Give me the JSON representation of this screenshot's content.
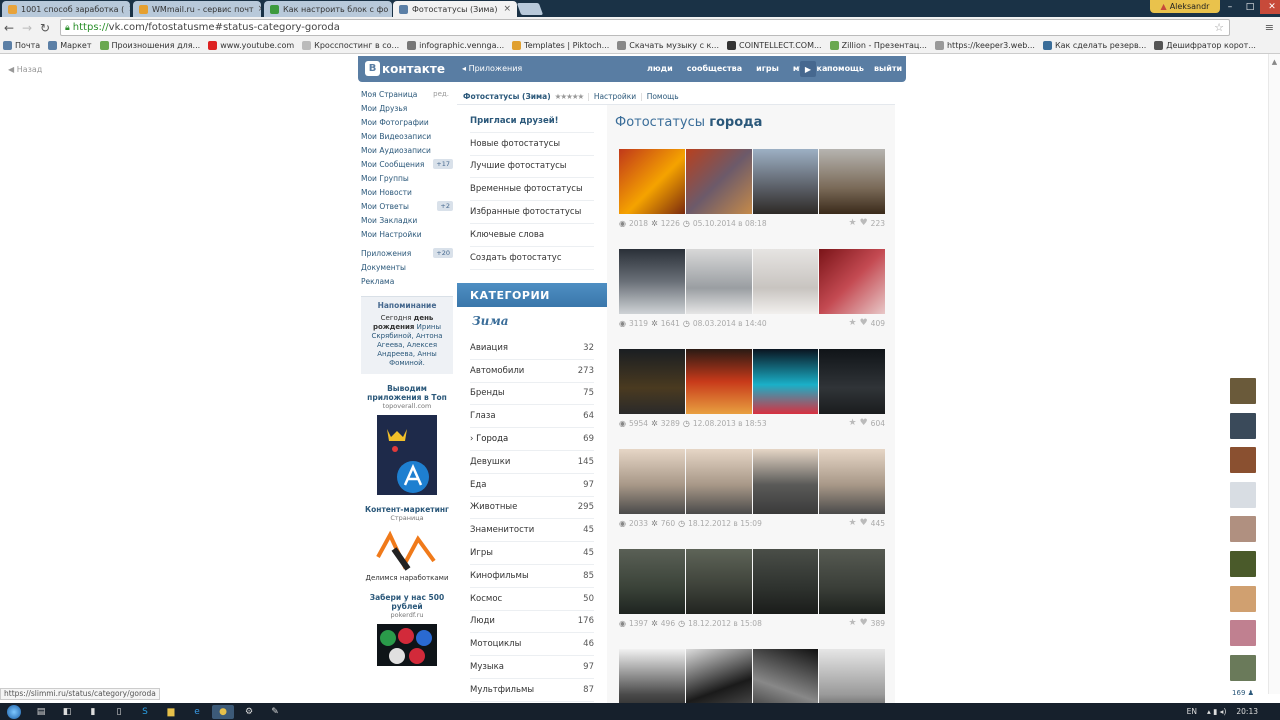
{
  "browser": {
    "tabs": [
      {
        "title": "1001 способ заработка (",
        "color": "#e8a33a"
      },
      {
        "title": "WMmail.ru - сервис почт",
        "color": "#e6a030"
      },
      {
        "title": "Как настроить блок с фо",
        "color": "#3d9a3d"
      },
      {
        "title": "Фотостатусы (Зима)",
        "color": "#5b7fa6"
      }
    ],
    "user_name": "Aleksandr",
    "url_scheme": "https://",
    "url_rest": "vk.com/fotostatusme#status-category-goroda",
    "bookmarks": [
      {
        "label": "Почта",
        "color": "#5b7fa6"
      },
      {
        "label": "Маркет",
        "color": "#5b7fa6"
      },
      {
        "label": "Произношения для...",
        "color": "#6aa84f"
      },
      {
        "label": "www.youtube.com",
        "color": "#d22"
      },
      {
        "label": "Кросспостинг в со...",
        "color": "#bbb"
      },
      {
        "label": "infographic.venngа...",
        "color": "#777"
      },
      {
        "label": "Templates | Piktoch...",
        "color": "#e0a030"
      },
      {
        "label": "Скачать музыку с к...",
        "color": "#888"
      },
      {
        "label": "COINTELLECT.COM...",
        "color": "#333"
      },
      {
        "label": "Zillion - Презентац...",
        "color": "#6aa84f"
      },
      {
        "label": "https://keeper3.web...",
        "color": "#999"
      },
      {
        "label": "Как сделать резерв...",
        "color": "#3a6d99"
      },
      {
        "label": "Дешифратор корот...",
        "color": "#555"
      }
    ],
    "status_url": "https://slimmi.ru/status/category/goroda"
  },
  "back_link": "Назад",
  "vk": {
    "logo_text": "контакте",
    "logo_letter": "В",
    "apps_label": "Приложения",
    "nav": [
      "люди",
      "сообщества",
      "игры",
      "музыка"
    ],
    "nav2": [
      "помощь",
      "выйти"
    ],
    "accent": "#597da3"
  },
  "left_menu": {
    "edit_label": "ред.",
    "items": [
      {
        "label": "Моя Страница",
        "badge": ""
      },
      {
        "label": "Мои Друзья",
        "badge": ""
      },
      {
        "label": "Мои Фотографии",
        "badge": ""
      },
      {
        "label": "Мои Видеозаписи",
        "badge": ""
      },
      {
        "label": "Мои Аудиозаписи",
        "badge": ""
      },
      {
        "label": "Мои Сообщения",
        "badge": "+17"
      },
      {
        "label": "Мои Группы",
        "badge": ""
      },
      {
        "label": "Мои Новости",
        "badge": ""
      },
      {
        "label": "Мои Ответы",
        "badge": "+2"
      },
      {
        "label": "Мои Закладки",
        "badge": ""
      },
      {
        "label": "Мои Настройки",
        "badge": ""
      }
    ],
    "items2": [
      {
        "label": "Приложения",
        "badge": "+20"
      },
      {
        "label": "Документы",
        "badge": ""
      },
      {
        "label": "Реклама",
        "badge": ""
      }
    ]
  },
  "reminder": {
    "title": "Напоминание",
    "text_a": "Сегодня",
    "text_b": "день рождения",
    "names": "Ирины Скрябиной, Антона Агеева, Алексея Андреева, Анны Фоминой."
  },
  "ads": [
    {
      "title": "Выводим приложения в Топ",
      "sub": "topoverall.com"
    },
    {
      "title": "Контент-маркетинг",
      "sub": "Страница",
      "caption": "Делимся наработками"
    },
    {
      "title": "Забери у нас 500 рублей",
      "sub": "pokerdf.ru"
    }
  ],
  "breadcrumb": {
    "app": "Фотостатусы (Зима)",
    "stars": "★★★★★",
    "settings": "Настройки",
    "help": "Помощь"
  },
  "sub_menu": [
    "Пригласи друзей!",
    "Новые фотостатусы",
    "Лучшие фотостатусы",
    "Временные фотостатусы",
    "Избранные фотостатусы",
    "Ключевые слова",
    "Создать фотостатус"
  ],
  "categories": {
    "header": "КАТЕГОРИИ",
    "season": "Зима",
    "items": [
      {
        "name": "Авиация",
        "count": "32"
      },
      {
        "name": "Автомобили",
        "count": "273"
      },
      {
        "name": "Бренды",
        "count": "75"
      },
      {
        "name": "Глаза",
        "count": "64"
      },
      {
        "name": "Города",
        "count": "69",
        "selected": true
      },
      {
        "name": "Девушки",
        "count": "145"
      },
      {
        "name": "Еда",
        "count": "97"
      },
      {
        "name": "Животные",
        "count": "295"
      },
      {
        "name": "Знаменитости",
        "count": "45"
      },
      {
        "name": "Игры",
        "count": "45"
      },
      {
        "name": "Кинофильмы",
        "count": "85"
      },
      {
        "name": "Космос",
        "count": "50"
      },
      {
        "name": "Люди",
        "count": "176"
      },
      {
        "name": "Мотоциклы",
        "count": "46"
      },
      {
        "name": "Музыка",
        "count": "97"
      },
      {
        "name": "Мультфильмы",
        "count": "87"
      }
    ]
  },
  "photos": {
    "title_a": "Фотостатусы",
    "title_b": "города",
    "sets": [
      {
        "views": "2018",
        "uses": "1226",
        "date": "05.10.2014 в 08:18",
        "likes": "223",
        "colors": [
          "linear-gradient(135deg,#c0381a,#f5a300 55%,#7a2a0e)",
          "linear-gradient(135deg,#b8401e,#6c5a6a 50%,#c58a4a)",
          "linear-gradient(180deg,#9db0c4,#5a5e66 60%,#2e2a26)",
          "linear-gradient(180deg,#b6b4b0,#7a6a58 60%,#3a2a1a)"
        ]
      },
      {
        "views": "3119",
        "uses": "1641",
        "date": "08.03.2014 в 14:40",
        "likes": "409",
        "colors": [
          "linear-gradient(180deg,#2a3038,#6a7078 50%,#cfd3d6)",
          "linear-gradient(180deg,#d8d8d8,#9a9ea2 60%,#e6e6e6)",
          "linear-gradient(180deg,#e6e4e2,#c8c4c0 60%,#f2f0ee)",
          "linear-gradient(135deg,#7a1418,#c44a52 50%,#e8c8c8)"
        ]
      },
      {
        "views": "5954",
        "uses": "3289",
        "date": "12.08.2013 в 18:53",
        "likes": "604",
        "colors": [
          "linear-gradient(180deg,#1a1e22,#4a3a20 60%,#2a2a2a)",
          "linear-gradient(180deg,#2a1a14,#c83a1a 50%,#e8a040)",
          "linear-gradient(180deg,#0a1420,#1ab0c8 55%,#d83040)",
          "linear-gradient(180deg,#101418,#303438 60%,#1a1c1e)"
        ]
      },
      {
        "views": "2033",
        "uses": "760",
        "date": "18.12.2012 в 15:09",
        "likes": "445",
        "colors": [
          "linear-gradient(180deg,#e6d6c6,#a89888 55%,#4a4a4a)",
          "linear-gradient(180deg,#e6d6c6,#a89888 55%,#4a4a4a)",
          "linear-gradient(180deg,#e6d6c6,#5a5a58 55%,#3a3a3a)",
          "linear-gradient(180deg,#e6d6c6,#a89888 55%,#4a4a4a)"
        ]
      },
      {
        "views": "1397",
        "uses": "496",
        "date": "18.12.2012 в 15:08",
        "likes": "389",
        "colors": [
          "linear-gradient(180deg,#5a6056,#3a4238 60%,#1e2420)",
          "linear-gradient(180deg,#5e6458,#3c4038 60%,#222420)",
          "linear-gradient(180deg,#4a4e48,#2e322e 60%,#1a1c1a)",
          "linear-gradient(180deg,#565a52,#3a3e38 60%,#1c201c)"
        ]
      },
      {
        "views": "",
        "uses": "",
        "date": "",
        "likes": "",
        "colors": [
          "linear-gradient(180deg,#f2f2f2,#4a4a4a 70%,#222)",
          "linear-gradient(160deg,#ddd,#1a1a1a 60%,#555)",
          "linear-gradient(200deg,#111,#888 60%,#333)",
          "linear-gradient(180deg,#e6e6e6,#9a9a9a 70%,#555)"
        ]
      }
    ]
  },
  "right_avatars": {
    "colors": [
      "#6a5a3a",
      "#3a4a5a",
      "#8a5030",
      "#d8dde3",
      "#b09080",
      "#4a5a2a",
      "#d0a070",
      "#c08090",
      "#6a7a5a"
    ],
    "count": "169"
  },
  "taskbar": {
    "lang": "EN",
    "time": "20:13"
  }
}
